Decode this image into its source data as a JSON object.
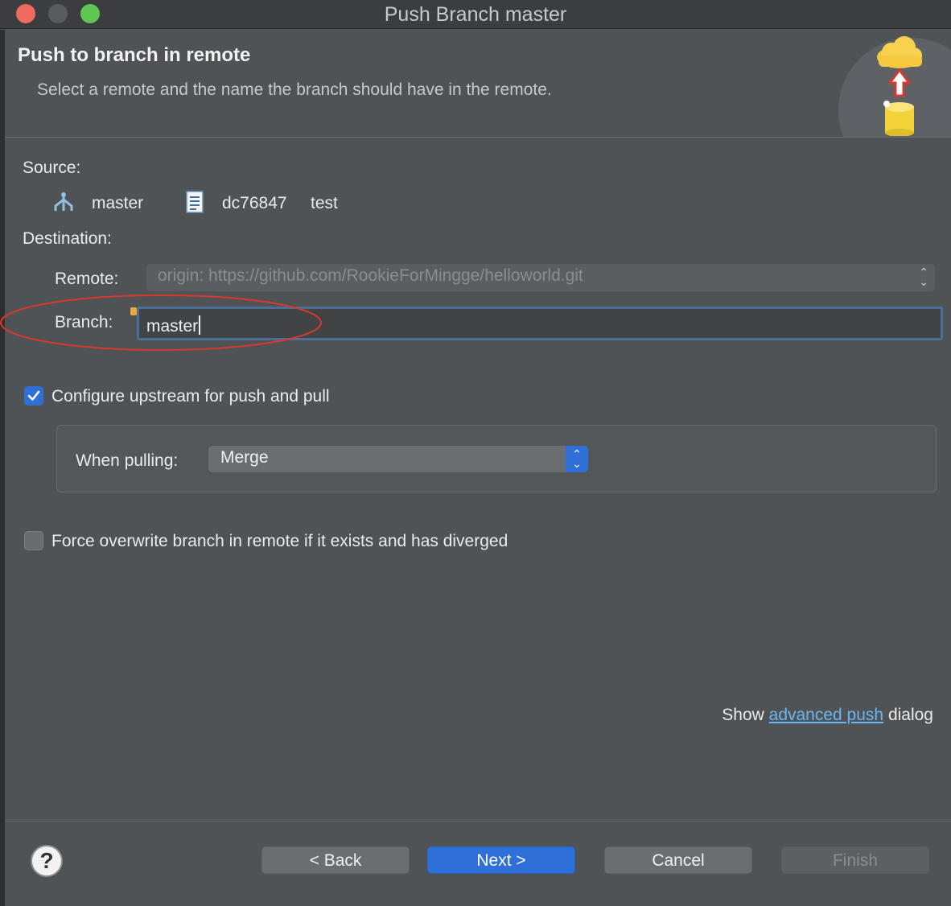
{
  "window": {
    "title": "Push Branch master"
  },
  "header": {
    "title": "Push to branch in remote",
    "description": "Select a remote and the name the branch should have in the remote."
  },
  "source": {
    "label": "Source:",
    "branch": "master",
    "commit_id": "dc76847",
    "commit_message": "test"
  },
  "destination": {
    "label": "Destination:",
    "remote_label": "Remote:",
    "remote_value": "origin: https://github.com/RookieForMingge/helloworld.git",
    "branch_label": "Branch:",
    "branch_value": "master"
  },
  "upstream": {
    "checkbox_label": "Configure upstream for push and pull",
    "checked": true,
    "pulling_label": "When pulling:",
    "pulling_value": "Merge"
  },
  "force": {
    "checkbox_label": "Force overwrite branch in remote if it exists and has diverged",
    "checked": false
  },
  "advanced": {
    "prefix": "Show",
    "link": "advanced push",
    "suffix": "dialog"
  },
  "buttons": {
    "back": "< Back",
    "next": "Next >",
    "cancel": "Cancel",
    "finish": "Finish",
    "help": "?"
  },
  "colors": {
    "accent": "#2f6fd8",
    "link": "#6ab6f5",
    "annotation": "#d9382c"
  }
}
